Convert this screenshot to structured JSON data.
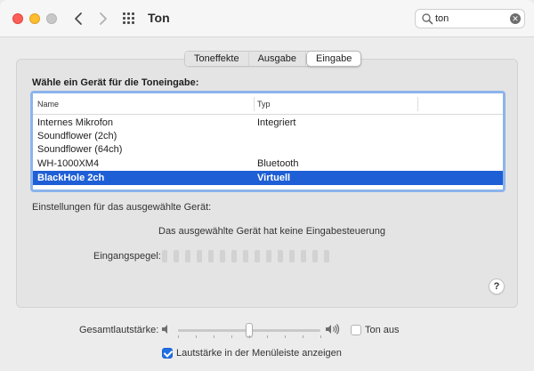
{
  "window": {
    "title": "Ton"
  },
  "search": {
    "value": "ton"
  },
  "tabs": [
    {
      "label": "Toneffekte",
      "active": false
    },
    {
      "label": "Ausgabe",
      "active": false
    },
    {
      "label": "Eingabe",
      "active": true
    }
  ],
  "input": {
    "heading": "Wähle ein Gerät für die Toneingabe:",
    "columns": {
      "name": "Name",
      "type": "Typ"
    },
    "rows": [
      {
        "name": "Internes Mikrofon",
        "type": "Integriert",
        "selected": false
      },
      {
        "name": "Soundflower (2ch)",
        "type": "",
        "selected": false
      },
      {
        "name": "Soundflower (64ch)",
        "type": "",
        "selected": false
      },
      {
        "name": "WH-1000XM4",
        "type": "Bluetooth",
        "selected": false
      },
      {
        "name": "BlackHole 2ch",
        "type": "Virtuell",
        "selected": true
      }
    ],
    "settings_label": "Einstellungen für das ausgewählte Gerät:",
    "no_control_text": "Das ausgewählte Gerät hat keine Eingabesteuerung",
    "level_label": "Eingangspegel:",
    "level_segments_total": 15,
    "level_segments_lit": 0
  },
  "help": {
    "label": "?"
  },
  "volume": {
    "label": "Gesamtlautstärke:",
    "level": 0.5,
    "mute_label": "Ton aus",
    "mute_checked": false,
    "menubar_label": "Lautstärke in der Menüleiste anzeigen",
    "menubar_checked": true
  },
  "colors": {
    "selection": "#1f5fd6",
    "focus_ring": "#8cb4ec",
    "close": "#ff5f57",
    "minimize": "#febc2e"
  }
}
